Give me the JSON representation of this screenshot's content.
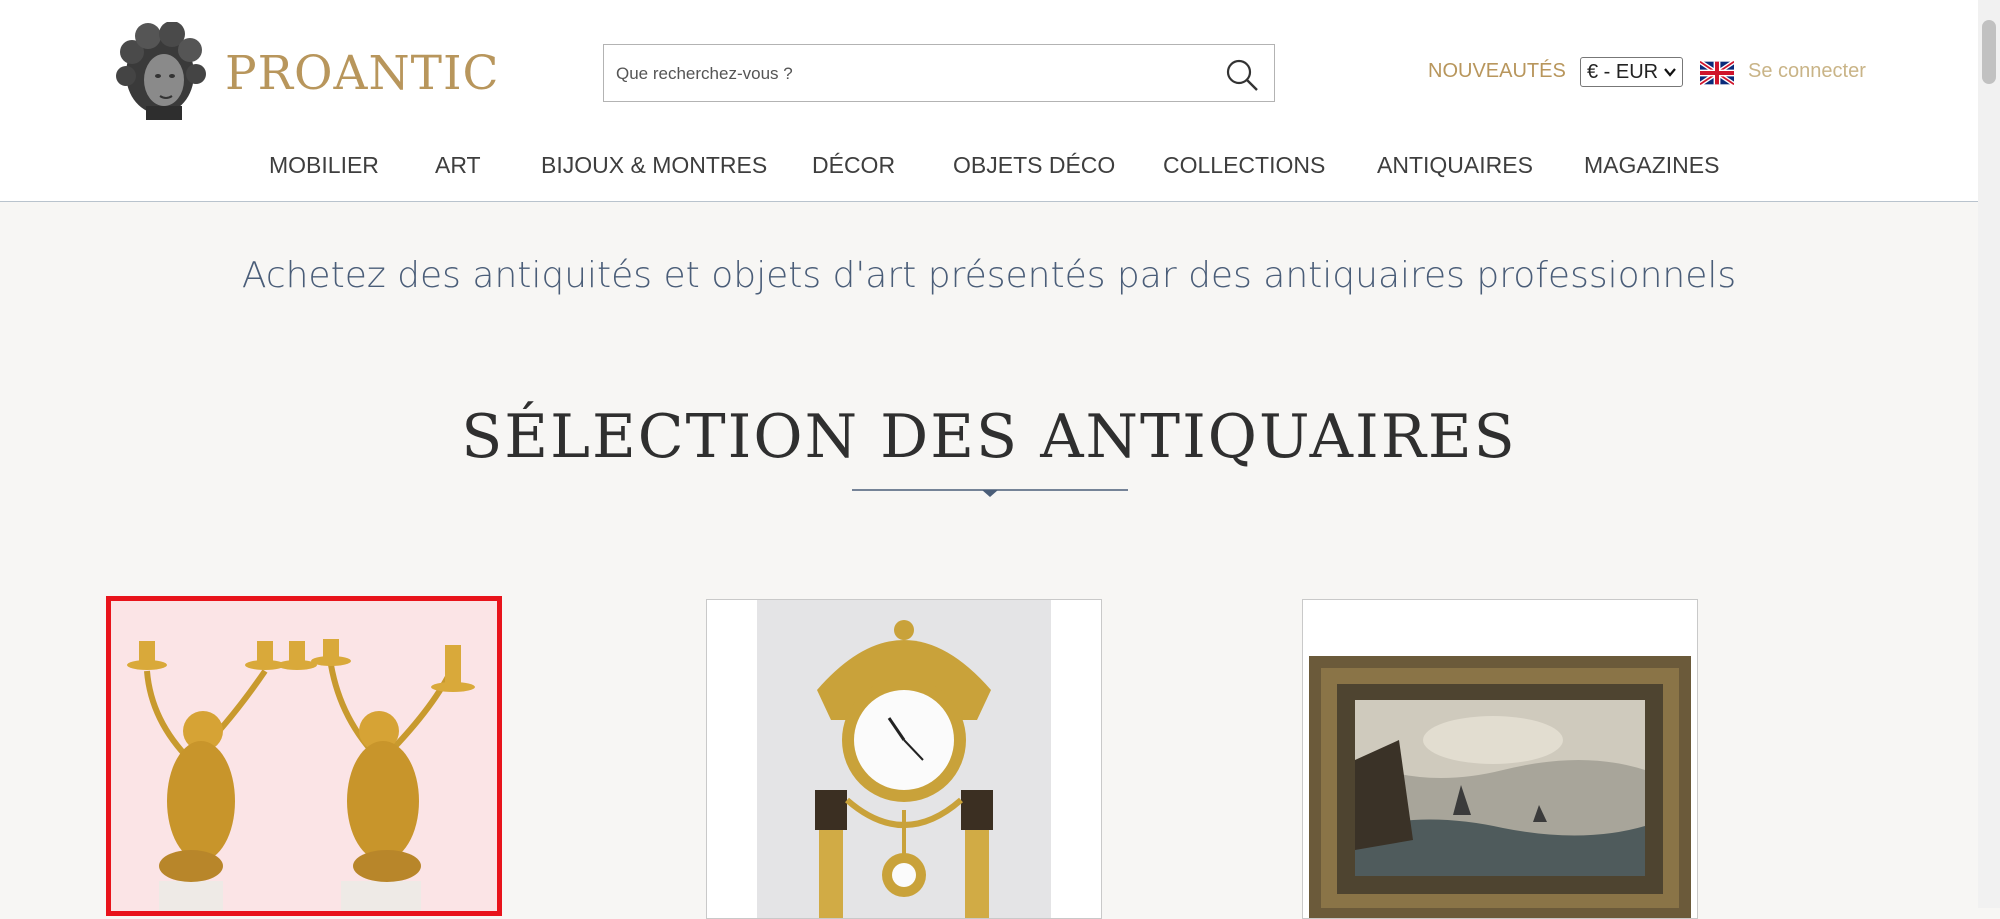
{
  "header": {
    "logo_text": "PROANTIC",
    "search": {
      "placeholder": "Que recherchez-vous ?"
    },
    "nouveautes_label": "NOUVEAUTÉS",
    "currency": {
      "selected": "€ - EUR"
    },
    "language_flag_icon": "uk-flag-icon",
    "login_label": "Se connecter",
    "colors": {
      "gold": "#b8965c",
      "light_gold": "#c9b487"
    }
  },
  "nav": {
    "items": [
      {
        "label": "MOBILIER"
      },
      {
        "label": "ART"
      },
      {
        "label": "BIJOUX & MONTRES"
      },
      {
        "label": "DÉCOR"
      },
      {
        "label": "OBJETS DÉCO"
      },
      {
        "label": "COLLECTIONS"
      },
      {
        "label": "ANTIQUAIRES"
      },
      {
        "label": "MAGAZINES"
      }
    ]
  },
  "main": {
    "tagline": "Achetez des antiquités et objets d'art présentés par des antiquaires professionnels",
    "section_title": "SÉLECTION DES ANTIQUAIRES",
    "accent_color": "#4a5d78",
    "selection_highlight_color": "#e8131b"
  }
}
